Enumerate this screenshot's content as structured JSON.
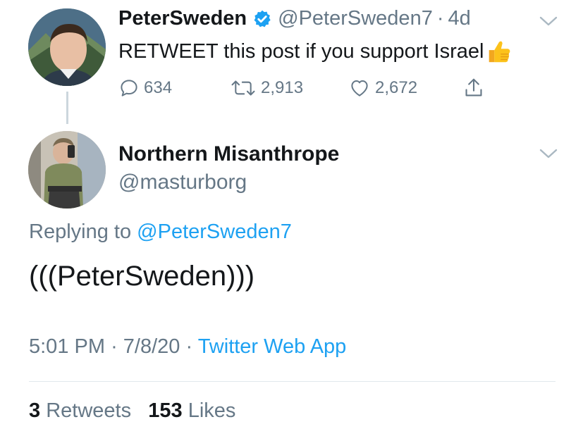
{
  "parent_tweet": {
    "name": "PeterSweden",
    "handle": "@PeterSweden7",
    "time": "4d",
    "text": "RETWEET this post if you support Israel",
    "replies": "634",
    "retweets": "2,913",
    "likes": "2,672"
  },
  "reply_tweet": {
    "name": "Northern Misanthrope",
    "handle": "@masturborg",
    "replying_prefix": "Replying to",
    "replying_handle": "@PeterSweden7",
    "text": "(((PeterSweden)))",
    "time": "5:01 PM",
    "date": "7/8/20",
    "source": "Twitter Web App"
  },
  "stats": {
    "retweet_count": "3",
    "retweet_label": "Retweets",
    "like_count": "153",
    "like_label": "Likes"
  },
  "colors": {
    "link": "#1da1f2",
    "muted": "#657786",
    "text": "#14171a",
    "thread_line": "#ccd6dd"
  }
}
